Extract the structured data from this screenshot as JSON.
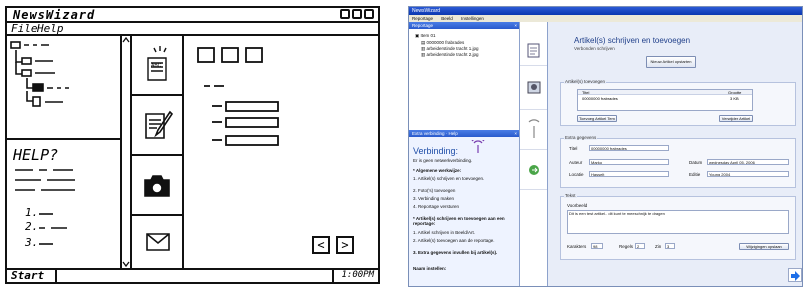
{
  "sketch": {
    "app_title": "NewsWizard",
    "menu": [
      "File",
      "Help"
    ],
    "help_heading": "HELP?",
    "help_steps": [
      "1.",
      "2.",
      "3."
    ],
    "status_left": "Start",
    "status_right": "1:00PM",
    "nav_prev": "<",
    "nav_next": ">"
  },
  "screenshot": {
    "window_title": "NewsWizard",
    "menu": [
      "Reportage",
      "Beeld",
      "Instellingen"
    ],
    "tree_header": "Reportage",
    "tree_items": [
      "Item 01",
      "0000000 frabrades",
      "arbeiderstinde tracht 1.jpg",
      "arbeiderstinde tracht 2.jpg"
    ],
    "help_header": "Extra verbinding · Help",
    "help_title": "Verbinding:",
    "help_lines": [
      "Er is geen netwerkverbinding.",
      "* Algemene werkwijze:",
      "1. Artikel(s) schrijven en toevoegen.",
      "2. Foto('s) toevoegen",
      "3. Verbinding maken",
      "4. Reportage versturen",
      "* Artikel(s) schrijven en toevoegen aan een reportage:",
      "1. Artikel schrijven in Beeld/Art.",
      "2. Artikel(s) toevoegen aan de reportage.",
      "3. Extra gegevens invullen bij artikel(s).",
      "Naam instellen:"
    ],
    "page_title": "Artikel(s) schrijven en toevoegen",
    "page_subtitle": "Verbonden schrijven",
    "new_article_button": "Nieuw Artikel opstarten",
    "articles_section": "Artikel(s) toevoegen",
    "articles_table": {
      "headers": [
        "Titel",
        "Grootte"
      ],
      "rows": [
        [
          "00000000 frabrades",
          "3 KB"
        ]
      ]
    },
    "add_article_button": "Toevoeg Artikel Tem",
    "remove_article_button": "Verwijder Artikel",
    "extra_section": "Extra gegevens",
    "fields": {
      "titel_label": "Titel",
      "titel_value": "00000000 frabrades",
      "auteur_label": "Auteur",
      "auteur_value": "Marko",
      "datum_label": "Datum",
      "datum_value": "wednesday April 05, 2006",
      "locatie_label": "Locatie",
      "locatie_value": "Hasselt",
      "editie_label": "Editie",
      "editie_value": "Young 2004"
    },
    "tekst_section": "Tekst",
    "voorbeeld_label": "Voorbeeld",
    "voorbeeld_text": "Dit is een test artikel.. dit kunt te meeschnijk te dragen",
    "stats": {
      "karakters_label": "Karakters",
      "karakters_value": "98",
      "regels_label": "Regels",
      "regels_value": "2",
      "zin_label": "Zin",
      "zin_value": "3"
    },
    "wijzigen_button": "Wijzigingen opslaan",
    "colors": {
      "accent": "#2a5bcc",
      "arrow": "#1e6fe8"
    }
  }
}
